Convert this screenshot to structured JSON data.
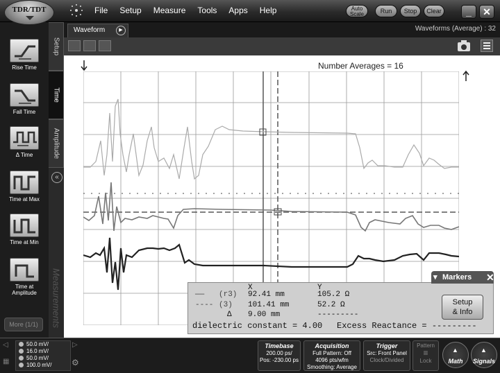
{
  "app": {
    "logo": "TDR/TDT"
  },
  "menu": {
    "items": [
      "File",
      "Setup",
      "Measure",
      "Tools",
      "Apps",
      "Help"
    ]
  },
  "controls": {
    "autoscale": [
      "Auto",
      "Scale"
    ],
    "run": "Run",
    "stop": "Stop",
    "clear": "Clear"
  },
  "tools": [
    {
      "label": "Rise Time"
    },
    {
      "label": "Fall Time"
    },
    {
      "label": "Δ Time"
    },
    {
      "label": "Time at Max"
    },
    {
      "label": "Time at Min"
    },
    {
      "label": "Time at Amplitude"
    }
  ],
  "more_label": "More (1/1)",
  "vtabs": {
    "setup": "Setup",
    "time": "Time",
    "amplitude": "Amplitude",
    "measurements": "Measurements"
  },
  "waveform": {
    "tab": "Waveform",
    "averages": "Waveforms (Average) : 32"
  },
  "plot": {
    "annotation": "Number Averages = 16"
  },
  "markers": {
    "title": "Markers",
    "col_x": "X",
    "col_y": "Y",
    "row1_label": "(r3)",
    "row1_x": "92.41 mm",
    "row1_y": "105.2 Ω",
    "row2_label": "(3)",
    "row2_x": "101.41 mm",
    "row2_y": "52.2 Ω",
    "delta_label": "Δ",
    "delta_x": "9.00 mm",
    "delta_y": "---------",
    "dielectric": "dielectric constant = 4.00",
    "reactance": "Excess Reactance = ---------",
    "setup_info": [
      "Setup",
      "& Info"
    ]
  },
  "channels": [
    "50.0 mV/",
    "16.0 mV/",
    "50.0 mV/",
    "100.0 mV/"
  ],
  "timebase": {
    "title": "Timebase",
    "line1": "200.00 ps/",
    "line2": "Pos: -230.00 ps"
  },
  "acquisition": {
    "title": "Acquisition",
    "line1": "Full Pattern: Off",
    "line2": "4096 pts/wfm",
    "line3": "Smoothing: Average"
  },
  "trigger": {
    "title": "Trigger",
    "line1": "Src: Front Panel",
    "line2": "Clock/Divided"
  },
  "pattern": {
    "title": "Pattern",
    "lock": "Lock"
  },
  "math": "Math",
  "signals": "Signals",
  "colors": {
    "background": "#2a2a2a",
    "plot": "#ffffff",
    "grid": "#999999",
    "trace_dark": "#222222"
  }
}
